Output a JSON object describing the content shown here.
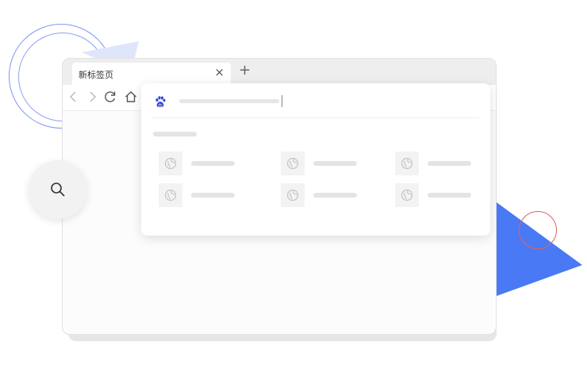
{
  "tab": {
    "title": "新标签页",
    "close": "×",
    "new": "+"
  },
  "colors": {
    "accent": "#4a79f5",
    "ring": "#7f97f0",
    "red": "#e06060"
  },
  "icons": {
    "back": "chevron-left-icon",
    "forward": "chevron-right-icon",
    "reload": "reload-icon",
    "home": "home-icon",
    "search": "search-icon",
    "engine": "baidu-paw-icon",
    "site": "globe-icon"
  }
}
